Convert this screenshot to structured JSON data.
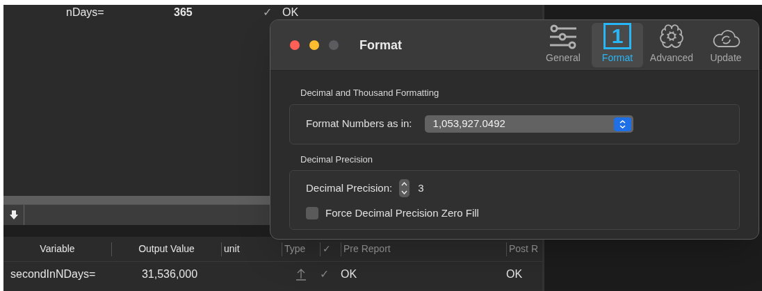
{
  "background_table": {
    "top_row": {
      "variable": "nDays=",
      "value": "365",
      "check": "✓",
      "pre_report": "OK"
    },
    "columns": [
      {
        "label": "Variable"
      },
      {
        "label": "Output Value"
      },
      {
        "label": "unit"
      },
      {
        "label": "Type"
      },
      {
        "label": "✓"
      },
      {
        "label": "Pre Report"
      },
      {
        "label": "Post R"
      }
    ],
    "rows": [
      {
        "variable": "secondInNDays=",
        "output_value": "31,536,000",
        "check": "✓",
        "pre_report": "OK",
        "post_report": "OK"
      }
    ]
  },
  "dialog": {
    "title": "Format",
    "tabs": [
      {
        "label": "General",
        "kind": "sliders",
        "selected": false
      },
      {
        "label": "Format",
        "kind": "number",
        "icon_text": "1",
        "selected": true
      },
      {
        "label": "Advanced",
        "kind": "brain",
        "selected": false
      },
      {
        "label": "Update",
        "kind": "cloud",
        "selected": false
      }
    ],
    "sections": [
      {
        "heading": "Decimal and Thousand Formatting",
        "popup": {
          "label": "Format Numbers as in:",
          "value": "1,053,927.0492"
        }
      },
      {
        "heading": "Decimal Precision",
        "stepper": {
          "label": "Decimal Precision:",
          "value": "3"
        },
        "checkbox": {
          "label": "Force Decimal Precision Zero Fill",
          "checked": false
        }
      }
    ]
  }
}
